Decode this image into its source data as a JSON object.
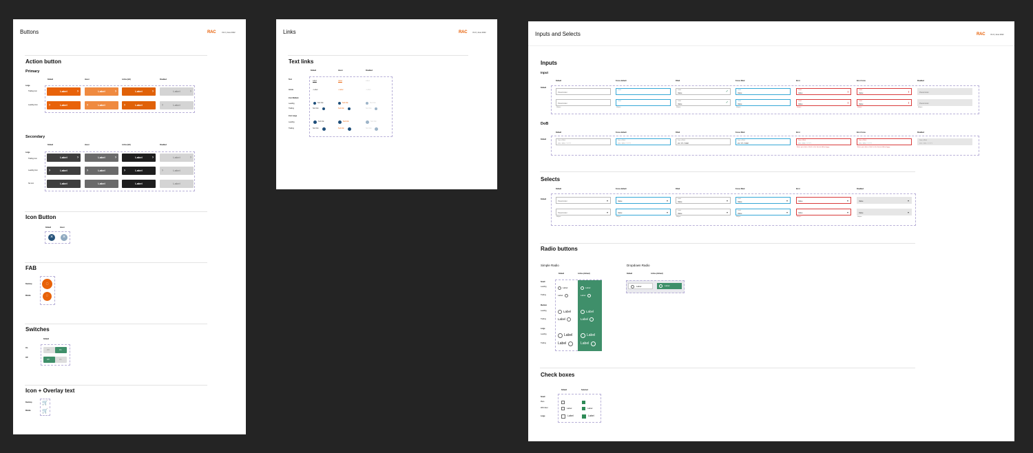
{
  "buttons_board": {
    "title": "Buttons",
    "logo": "RAC",
    "version": "V2.0 | June 2022",
    "action_button": {
      "heading": "Action button",
      "primary_label": "Primary",
      "columns": [
        "Default",
        "Hover",
        "Active (Hit)",
        "Disabled"
      ],
      "size_label": "Large",
      "row_labels": [
        "Trailing icon",
        "Leading Icon"
      ],
      "button_label": "Label"
    },
    "secondary": {
      "heading": "Secondary",
      "columns": [
        "Default",
        "Hover",
        "Active (Hit)",
        "Disabled"
      ],
      "size_label": "Large",
      "row_labels": [
        "Trailing icon",
        "Leading Icon",
        "No icon"
      ],
      "button_label": "Label"
    },
    "icon_button": {
      "heading": "Icon Button",
      "columns": [
        "Default",
        "Hover"
      ]
    },
    "fab": {
      "heading": "FAB",
      "rows": [
        "Desktop",
        "Mobile"
      ]
    },
    "switches": {
      "heading": "Switches",
      "column": "Default",
      "rows": [
        "On",
        "Off"
      ],
      "off_text": "Off",
      "on_text": "On"
    },
    "overlay": {
      "heading": "Icon + Overlay text",
      "rows": [
        "Desktop",
        "Mobile"
      ]
    }
  },
  "links_board": {
    "title": "Links",
    "logo": "RAC",
    "version": "V2.0 | June 2022",
    "heading": "Text links",
    "columns": [
      "Default",
      "Hover",
      "Disabled"
    ],
    "rows": [
      "Text",
      "Arrow",
      "Icon Medium",
      "Icon Large"
    ],
    "sub_rows": [
      "Leading",
      "Trailing"
    ],
    "link_text": "Label",
    "arrow_text": "‹ Label",
    "small_text": "Sub link"
  },
  "inputs_board": {
    "title": "Inputs and Selects",
    "logo": "RAC",
    "version": "V2.0 | June 2022",
    "inputs": {
      "heading": "Inputs",
      "sub": "Input",
      "columns": [
        "Default",
        "Focus default",
        "Filled",
        "Focus filled",
        "Error",
        "Error focus",
        "Disabled"
      ],
      "row_label": "Default",
      "placeholder": "Placeholder",
      "value": "Value",
      "label": "Label",
      "helper": "Helper"
    },
    "dob": {
      "heading": "DoB",
      "columns": [
        "Default",
        "Focus default",
        "Filled",
        "Focus filled",
        "Error",
        "Error focus",
        "Disabled"
      ],
      "row_label": "Default",
      "field_label": "Date of Birth",
      "format": "DD / MM / YYYY",
      "filled": "22 / 07 / 1992",
      "error_text": "Enter your date of birth in the format dd/mm/yyyy"
    },
    "selects": {
      "heading": "Selects",
      "columns": [
        "Default",
        "Focus default",
        "Filled",
        "Focus filled",
        "Error",
        "Disabled"
      ],
      "row_label": "Default",
      "placeholder": "Placeholder",
      "value": "Value",
      "label": "Label",
      "helper": "Helper"
    },
    "radio": {
      "heading": "Radio buttons",
      "simple": "Simple Radio",
      "dropdown": "Dropdown Radio",
      "columns": [
        "Default",
        "Active (clicked)"
      ],
      "sizes": [
        "Small",
        "Medium",
        "Large"
      ],
      "rows": [
        "Leading",
        "Trailing"
      ],
      "label": "Label"
    },
    "checkboxes": {
      "heading": "Check boxes",
      "columns": [
        "Default",
        "Selected"
      ],
      "size": "Small",
      "rows": [
        "Plain",
        "With label",
        "Large"
      ],
      "label": "Label"
    }
  },
  "colors": {
    "primary": "#e8620a",
    "primary_hover": "#ef8a40",
    "dark": "#3f3f3f",
    "green": "#3f8f6a",
    "focus": "#35a7d6",
    "error": "#d93a3a"
  }
}
